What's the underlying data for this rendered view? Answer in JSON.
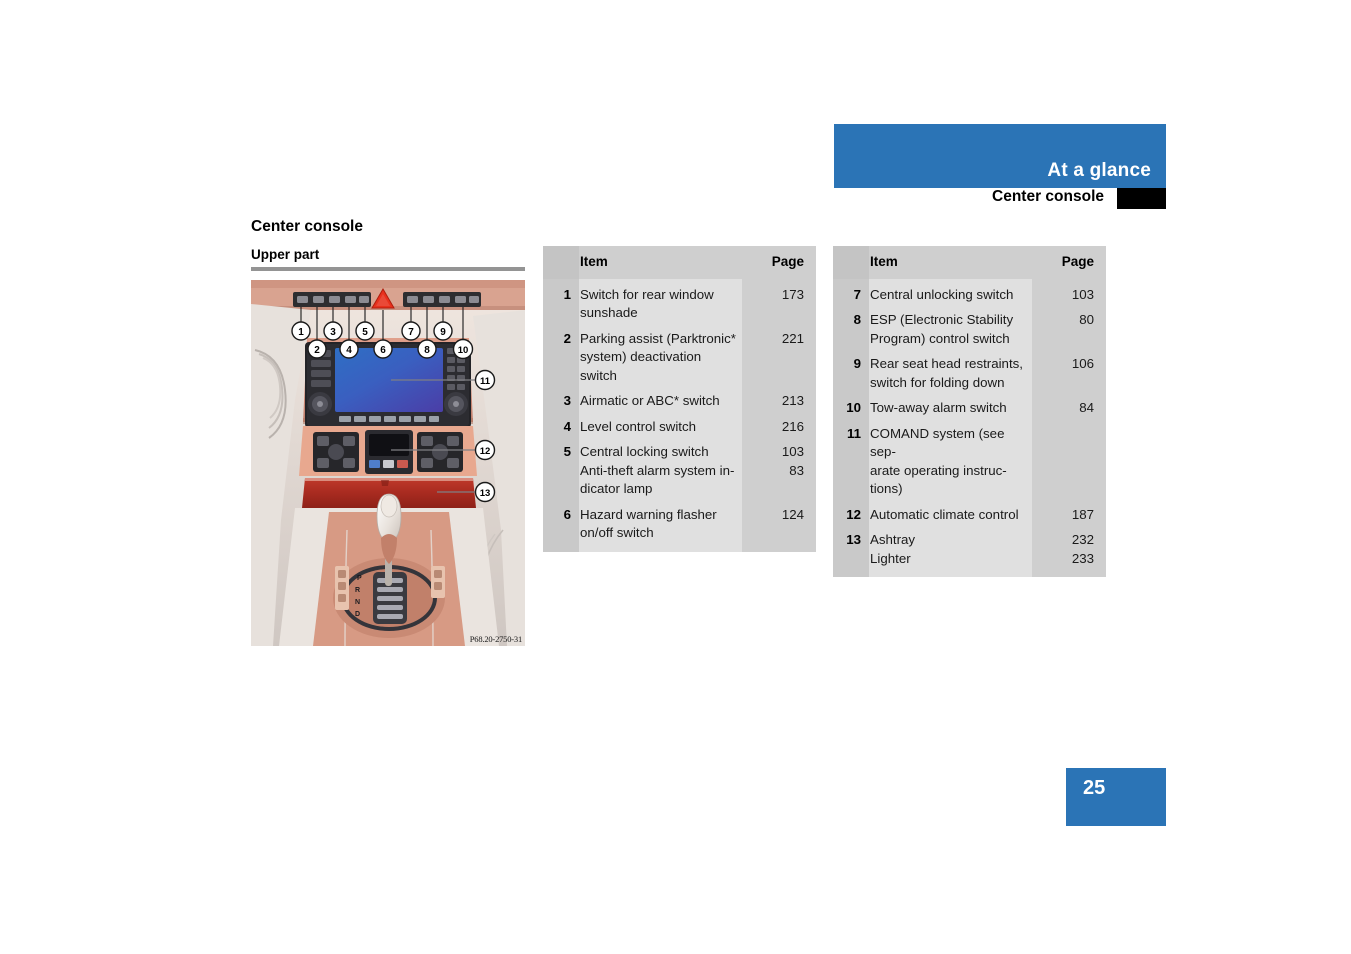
{
  "header": {
    "banner_title": "At a glance",
    "sub_title": "Center console"
  },
  "content": {
    "section_title": "Center console",
    "sub_heading": "Upper part"
  },
  "figure": {
    "caption": "P68.20-2750-31",
    "callouts": [
      "1",
      "2",
      "3",
      "4",
      "5",
      "6",
      "7",
      "8",
      "9",
      "10",
      "11",
      "12",
      "13"
    ],
    "alt": "Illustration of Mercedes-Benz center console upper part with numbered callouts"
  },
  "tables": {
    "left": {
      "headers": {
        "item": "Item",
        "page": "Page"
      },
      "rows": [
        {
          "num": "1",
          "item": [
            "Switch for rear window",
            "sunshade"
          ],
          "pages": [
            "173"
          ]
        },
        {
          "num": "2",
          "item": [
            "Parking assist (Parktronic*",
            "system) deactivation",
            "switch"
          ],
          "pages": [
            "221"
          ]
        },
        {
          "num": "3",
          "item": [
            "Airmatic or ABC* switch"
          ],
          "pages": [
            "213"
          ]
        },
        {
          "num": "4",
          "item": [
            "Level control switch"
          ],
          "pages": [
            "216"
          ]
        },
        {
          "num": "5",
          "item": [
            "Central locking switch",
            "Anti-theft alarm system in-",
            "dicator lamp"
          ],
          "pages": [
            "103",
            "83"
          ]
        },
        {
          "num": "6",
          "item": [
            "Hazard warning flasher",
            "on/off switch"
          ],
          "pages": [
            "124"
          ]
        }
      ]
    },
    "right": {
      "headers": {
        "item": "Item",
        "page": "Page"
      },
      "rows": [
        {
          "num": "7",
          "item": [
            "Central unlocking switch"
          ],
          "pages": [
            "103"
          ]
        },
        {
          "num": "8",
          "item": [
            "ESP (Electronic Stability",
            "Program) control switch"
          ],
          "pages": [
            "80"
          ]
        },
        {
          "num": "9",
          "item": [
            "Rear seat head restraints,",
            "switch for folding down"
          ],
          "pages": [
            "106"
          ]
        },
        {
          "num": "10",
          "item": [
            "Tow-away alarm switch"
          ],
          "pages": [
            "84"
          ]
        },
        {
          "num": "11",
          "item": [
            "COMAND system (see sep-",
            "arate operating instruc-",
            "tions)"
          ],
          "pages": []
        },
        {
          "num": "12",
          "item": [
            "Automatic climate control"
          ],
          "pages": [
            "187"
          ]
        },
        {
          "num": "13",
          "item": [
            "Ashtray",
            "Lighter"
          ],
          "pages": [
            "232",
            "233"
          ]
        }
      ]
    }
  },
  "footer": {
    "page_number": "25"
  },
  "colors": {
    "accent_blue": "#2b74b6",
    "tab_black": "#000000",
    "rule_gray": "#949494",
    "table_item_bg": "#e0e0e0",
    "table_num_bg": "#c9c9c9",
    "table_page_bg": "#cfcfcf"
  }
}
